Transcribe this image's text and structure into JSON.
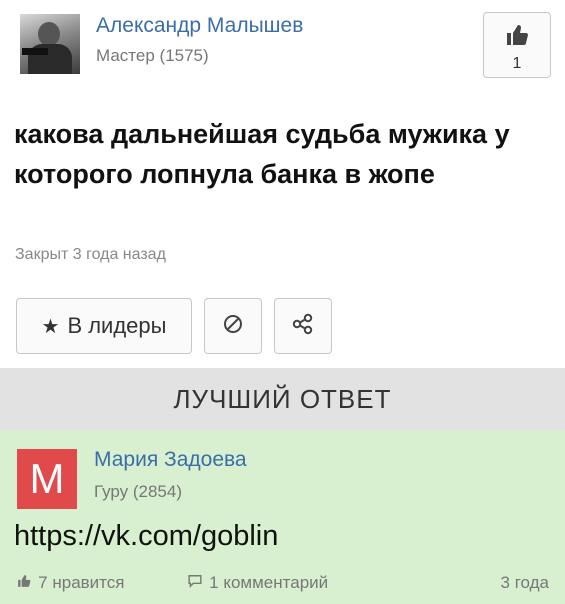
{
  "question": {
    "author_name": "Александр Малышев",
    "author_rank": "Мастер (1575)",
    "like_count": "1",
    "title": "какова дальнейшая судьба мужика у которого лопнула банка в жопе",
    "status": "Закрыт 3 года назад",
    "leaders_label": "В лидеры"
  },
  "best_answer_header": "ЛУЧШИЙ ОТВЕТ",
  "answer": {
    "avatar_letter": "M",
    "author_name": "Мария Задоева",
    "author_rank": "Гуру (2854)",
    "text": "https://vk.com/goblin",
    "likes": "7 нравится",
    "comments": "1 комментарий",
    "time": "3 года"
  },
  "icons": {
    "thumb": "thumbs-up-icon",
    "star": "star-icon",
    "block": "block-icon",
    "share": "share-icon",
    "comment": "comment-icon"
  },
  "colors": {
    "link": "#3b6ea8",
    "answer_bg": "#d8f0cf",
    "header_bg": "#e2e2e2",
    "avatar_red": "#e04a4a"
  }
}
